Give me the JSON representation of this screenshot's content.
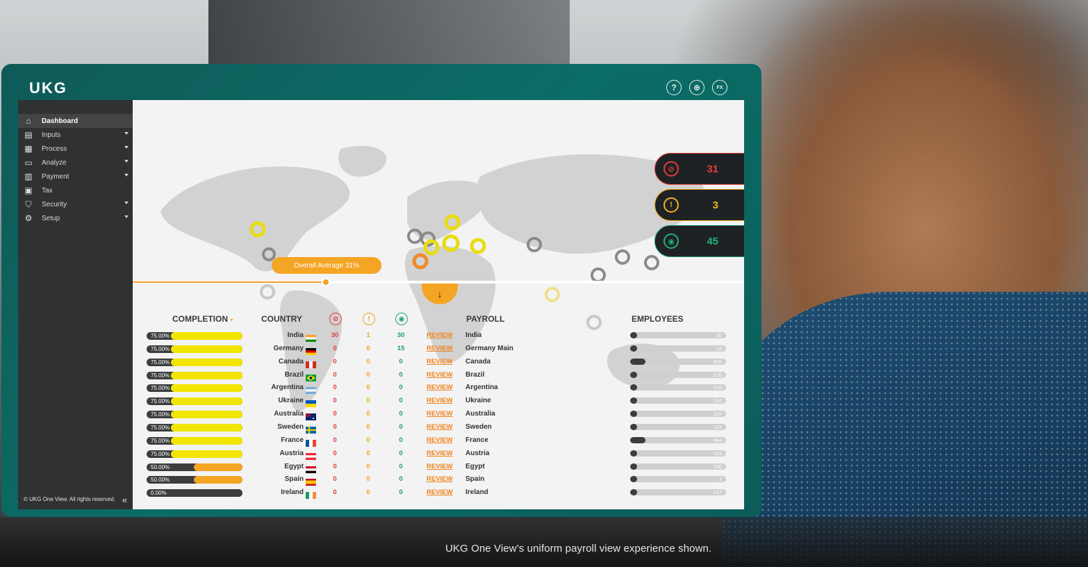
{
  "brand": {
    "logo": "UKG"
  },
  "header": {
    "icons": [
      {
        "name": "help-icon",
        "glyph": "?"
      },
      {
        "name": "globe-icon",
        "glyph": "⊕"
      },
      {
        "name": "fx-icon",
        "glyph": "FX"
      }
    ]
  },
  "sidebar": {
    "items": [
      {
        "label": "Dashboard",
        "icon": "home-icon",
        "glyph": "⌂",
        "expandable": false,
        "active": true
      },
      {
        "label": "Inputs",
        "icon": "inputs-icon",
        "glyph": "▤",
        "expandable": true,
        "active": false
      },
      {
        "label": "Process",
        "icon": "process-icon",
        "glyph": "▦",
        "expandable": true,
        "active": false
      },
      {
        "label": "Analyze",
        "icon": "analyze-icon",
        "glyph": "▭",
        "expandable": true,
        "active": false
      },
      {
        "label": "Payment",
        "icon": "payment-icon",
        "glyph": "▥",
        "expandable": true,
        "active": false
      },
      {
        "label": "Tax",
        "icon": "tax-icon",
        "glyph": "▣",
        "expandable": false,
        "active": false
      },
      {
        "label": "Security",
        "icon": "shield-icon",
        "glyph": "⛉",
        "expandable": true,
        "active": false
      },
      {
        "label": "Setup",
        "icon": "gear-icon",
        "glyph": "⚙",
        "expandable": true,
        "active": false
      }
    ],
    "copyright": "© UKG One View. All rights reserved.",
    "collapse_glyph": "«"
  },
  "map": {
    "overall_average": "Overall Average 31%",
    "average_value": 31
  },
  "status": {
    "errors": "31",
    "warnings": "3",
    "reviews": "45"
  },
  "table": {
    "headers": {
      "completion": "COMPLETION",
      "country": "COUNTRY",
      "payroll": "PAYROLL",
      "employees": "EMPLOYEES"
    },
    "rows": [
      {
        "completion": "75.00%",
        "pct": 75,
        "country": "India",
        "flag": "india",
        "errors": "30",
        "warnings": "1",
        "reviews": "30",
        "action": "REVIEW",
        "payroll": "India",
        "employees": "30",
        "emp_frac": 0.06
      },
      {
        "completion": "75.00%",
        "pct": 75,
        "country": "Germany",
        "flag": "germany",
        "errors": "0",
        "warnings": "0",
        "reviews": "15",
        "action": "REVIEW",
        "payroll": "Germany Main",
        "employees": "18",
        "emp_frac": 0.04
      },
      {
        "completion": "75.00%",
        "pct": 75,
        "country": "Canada",
        "flag": "canada",
        "errors": "0",
        "warnings": "0",
        "reviews": "0",
        "action": "REVIEW",
        "payroll": "Canada",
        "employees": "500",
        "emp_frac": 0.16
      },
      {
        "completion": "75.00%",
        "pct": 75,
        "country": "Brazil",
        "flag": "brazil",
        "errors": "0",
        "warnings": "0",
        "reviews": "0",
        "action": "REVIEW",
        "payroll": "Brazil",
        "employees": "120",
        "emp_frac": 0.06
      },
      {
        "completion": "75.00%",
        "pct": 75,
        "country": "Argentina",
        "flag": "argentina",
        "errors": "0",
        "warnings": "0",
        "reviews": "0",
        "action": "REVIEW",
        "payroll": "Argentina",
        "employees": "120",
        "emp_frac": 0.06
      },
      {
        "completion": "75.00%",
        "pct": 75,
        "country": "Ukraine",
        "flag": "ukraine",
        "errors": "0",
        "warnings": "0",
        "reviews": "0",
        "action": "REVIEW",
        "payroll": "Ukraine",
        "employees": "116",
        "emp_frac": 0.06
      },
      {
        "completion": "75.00%",
        "pct": 75,
        "country": "Australia",
        "flag": "australia",
        "errors": "0",
        "warnings": "0",
        "reviews": "0",
        "action": "REVIEW",
        "payroll": "Australia",
        "employees": "120",
        "emp_frac": 0.06
      },
      {
        "completion": "75.00%",
        "pct": 75,
        "country": "Sweden",
        "flag": "sweden",
        "errors": "0",
        "warnings": "0",
        "reviews": "0",
        "action": "REVIEW",
        "payroll": "Sweden",
        "employees": "115",
        "emp_frac": 0.06
      },
      {
        "completion": "75.00%",
        "pct": 75,
        "country": "France",
        "flag": "france",
        "errors": "0",
        "warnings": "0",
        "reviews": "0",
        "action": "REVIEW",
        "payroll": "France",
        "employees": "494",
        "emp_frac": 0.16
      },
      {
        "completion": "75.00%",
        "pct": 75,
        "country": "Austria",
        "flag": "austria",
        "errors": "0",
        "warnings": "0",
        "reviews": "0",
        "action": "REVIEW",
        "payroll": "Austria",
        "employees": "115",
        "emp_frac": 0.06
      },
      {
        "completion": "50.00%",
        "pct": 50,
        "country": "Egypt",
        "flag": "egypt",
        "errors": "0",
        "warnings": "0",
        "reviews": "0",
        "action": "REVIEW",
        "payroll": "Egypt",
        "employees": "100",
        "emp_frac": 0.06
      },
      {
        "completion": "50.00%",
        "pct": 50,
        "country": "Spain",
        "flag": "spain",
        "errors": "0",
        "warnings": "0",
        "reviews": "0",
        "action": "REVIEW",
        "payroll": "Spain",
        "employees": "2",
        "emp_frac": 0.06
      },
      {
        "completion": "0.00%",
        "pct": 0,
        "country": "Ireland",
        "flag": "ireland",
        "errors": "0",
        "warnings": "0",
        "reviews": "0",
        "action": "REVIEW",
        "payroll": "Ireland",
        "employees": "127",
        "emp_frac": 0.06
      }
    ]
  },
  "caption": "UKG One View’s uniform payroll view experience shown.",
  "colors": {
    "teal": "#0b6d67",
    "sidebar": "#2f3133",
    "orange": "#f5a524",
    "yellow": "#f2e600",
    "red": "#e43b3b",
    "green": "#1f9a7a"
  }
}
